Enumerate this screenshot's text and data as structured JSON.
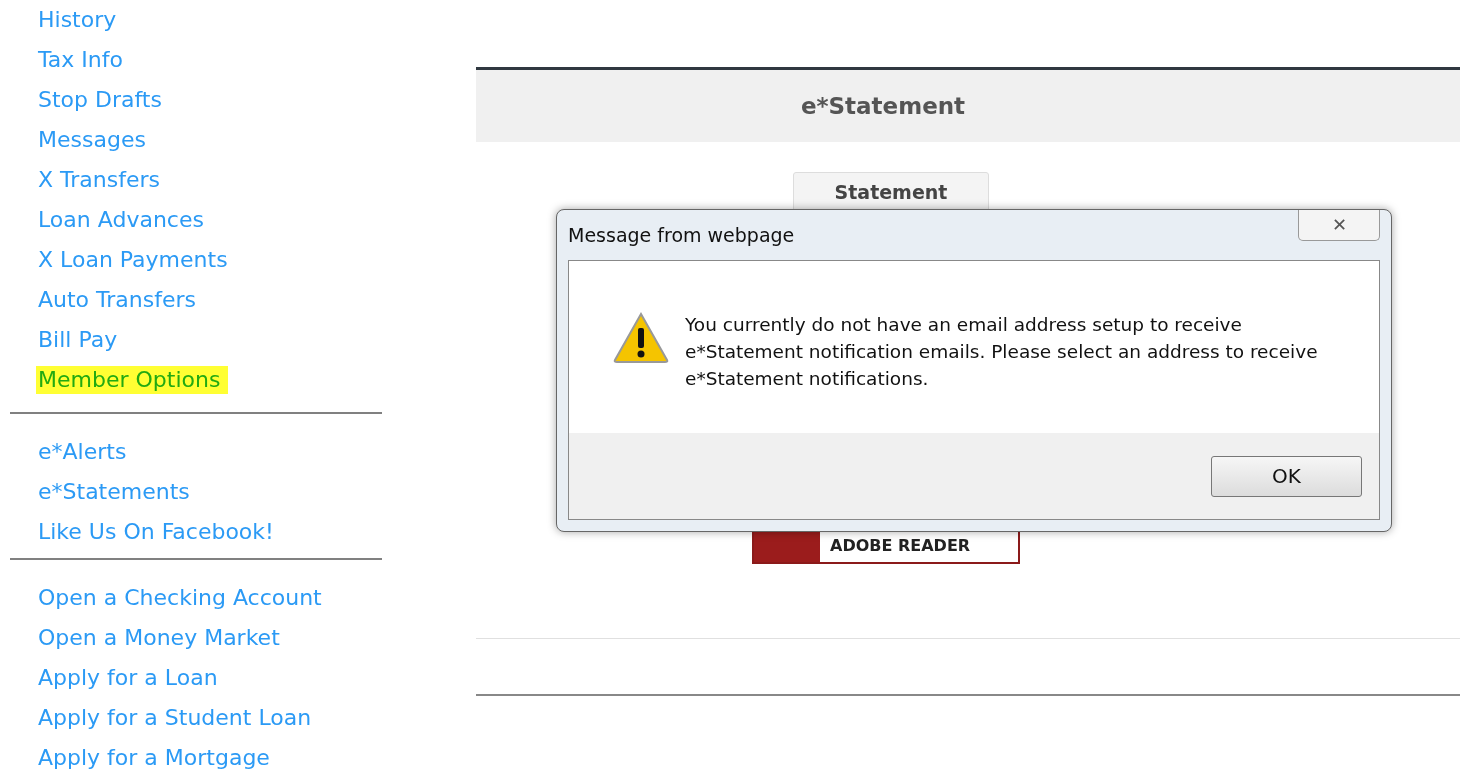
{
  "sidebar": {
    "groups": [
      {
        "items": [
          {
            "label": "History",
            "highlighted": false
          },
          {
            "label": "Tax Info",
            "highlighted": false
          },
          {
            "label": "Stop Drafts",
            "highlighted": false
          },
          {
            "label": "Messages",
            "highlighted": false
          },
          {
            "label": "X Transfers",
            "highlighted": false
          },
          {
            "label": "Loan Advances",
            "highlighted": false
          },
          {
            "label": "X Loan Payments",
            "highlighted": false
          },
          {
            "label": "Auto Transfers",
            "highlighted": false
          },
          {
            "label": "Bill Pay",
            "highlighted": false
          },
          {
            "label": "Member Options",
            "highlighted": true
          }
        ]
      },
      {
        "items": [
          {
            "label": "e*Alerts",
            "highlighted": false
          },
          {
            "label": "e*Statements",
            "highlighted": false
          },
          {
            "label": "Like Us On Facebook!",
            "highlighted": false
          }
        ]
      },
      {
        "items": [
          {
            "label": "Open a Checking Account",
            "highlighted": false
          },
          {
            "label": "Open a Money Market",
            "highlighted": false
          },
          {
            "label": "Apply for a Loan",
            "highlighted": false
          },
          {
            "label": "Apply for a Student Loan",
            "highlighted": false
          },
          {
            "label": "Apply for a Mortgage",
            "highlighted": false
          }
        ]
      }
    ]
  },
  "panel": {
    "title": "e*Statement",
    "statement_button": "Statement",
    "adobe_badge": "ADOBE READER"
  },
  "dialog": {
    "title": "Message from webpage",
    "close": "✕",
    "message": "You currently do not have an email address setup to receive e*Statement notification emails.  Please select an address to receive e*Statement notifications.",
    "button": "OK"
  }
}
